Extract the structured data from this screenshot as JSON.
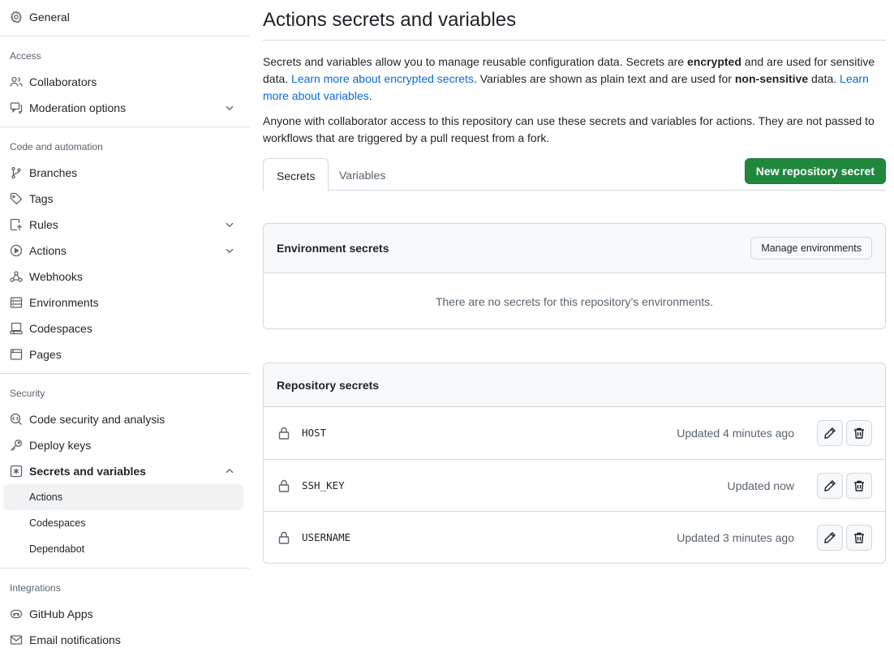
{
  "sidebar": {
    "general": "General",
    "access_head": "Access",
    "collaborators": "Collaborators",
    "moderation": "Moderation options",
    "code_head": "Code and automation",
    "branches": "Branches",
    "tags": "Tags",
    "rules": "Rules",
    "actions": "Actions",
    "webhooks": "Webhooks",
    "environments": "Environments",
    "codespaces": "Codespaces",
    "pages": "Pages",
    "security_head": "Security",
    "code_security": "Code security and analysis",
    "deploy_keys": "Deploy keys",
    "secrets_vars": "Secrets and variables",
    "sub_actions": "Actions",
    "sub_codespaces": "Codespaces",
    "sub_dependabot": "Dependabot",
    "integrations_head": "Integrations",
    "github_apps": "GitHub Apps",
    "email_notifications": "Email notifications"
  },
  "main": {
    "title": "Actions secrets and variables",
    "p1_a": "Secrets and variables allow you to manage reusable configuration data. Secrets are ",
    "p1_b": "encrypted",
    "p1_c": " and are used for sensitive data. ",
    "p1_link1": "Learn more about encrypted secrets",
    "p1_d": ". Variables are shown as plain text and are used for ",
    "p1_e": "non-sensitive",
    "p1_f": " data. ",
    "p1_link2": "Learn more about variables",
    "p1_g": ".",
    "p2": "Anyone with collaborator access to this repository can use these secrets and variables for actions. They are not passed to workflows that are triggered by a pull request from a fork.",
    "tab_secrets": "Secrets",
    "tab_variables": "Variables",
    "new_secret_btn": "New repository secret",
    "env_head": "Environment secrets",
    "manage_env_btn": "Manage environments",
    "env_empty": "There are no secrets for this repository’s environments.",
    "repo_head": "Repository secrets",
    "secrets": [
      {
        "name": "HOST",
        "updated": "Updated 4 minutes ago"
      },
      {
        "name": "SSH_KEY",
        "updated": "Updated now"
      },
      {
        "name": "USERNAME",
        "updated": "Updated 3 minutes ago"
      }
    ]
  },
  "colors": {
    "primary_button": "#1f883d",
    "link": "#0969da",
    "muted": "#59636e",
    "border": "#d1d9e0"
  }
}
